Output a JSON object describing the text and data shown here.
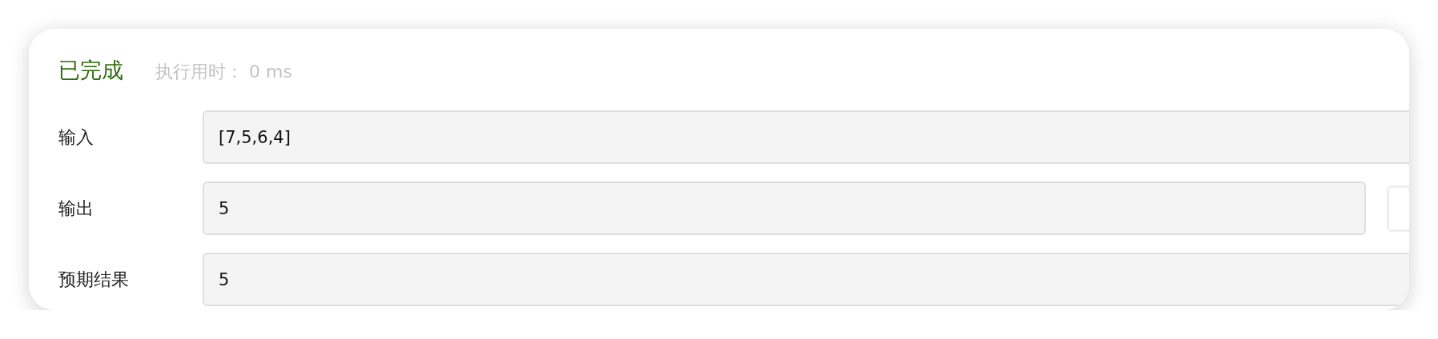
{
  "result": {
    "status": "已完成",
    "runtime": "执行用时： 0 ms"
  },
  "rows": [
    {
      "kind": "field",
      "label": "输入",
      "value": "[7,5,6,4]"
    },
    {
      "kind": "field_with_button",
      "label": "输出",
      "value": "5"
    },
    {
      "kind": "field",
      "label": "预期结果",
      "value": "5"
    }
  ]
}
